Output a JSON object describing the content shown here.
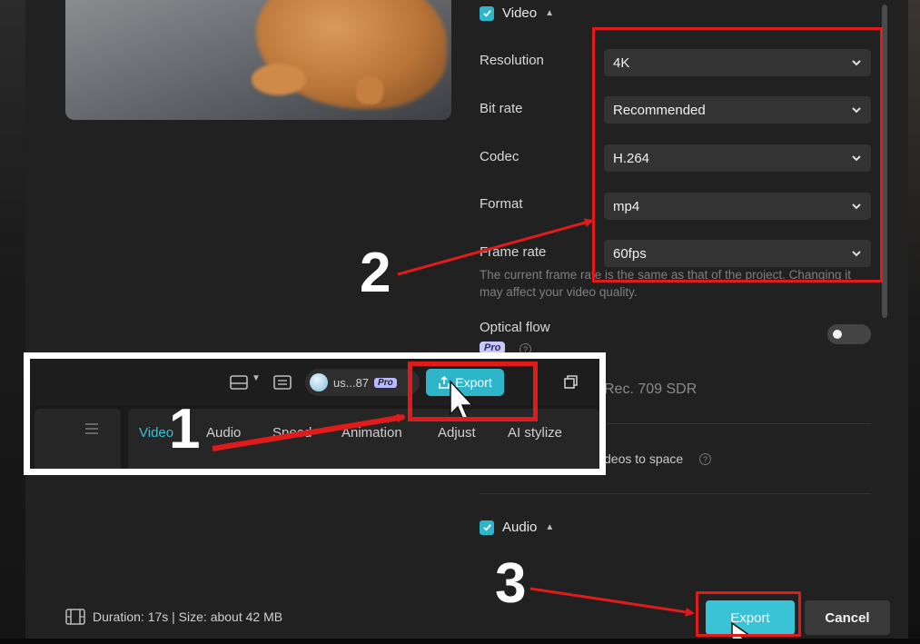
{
  "video_section": {
    "label": "Video",
    "checked": true
  },
  "settings": [
    {
      "label": "Resolution",
      "value": "4K"
    },
    {
      "label": "Bit rate",
      "value": "Recommended"
    },
    {
      "label": "Codec",
      "value": "H.264"
    },
    {
      "label": "Format",
      "value": "mp4"
    },
    {
      "label": "Frame rate",
      "value": "60fps"
    }
  ],
  "frame_rate_hint": "The current frame rate is the same as that of the project. Changing it may affect your video quality.",
  "optical_flow": {
    "label": "Optical flow",
    "badge": "Pro",
    "enabled": false
  },
  "color_space": "Rec. 709 SDR",
  "save_to_space": "deos to space",
  "audio_section": {
    "label": "Audio",
    "checked": true
  },
  "footer": {
    "info": "Duration: 17s | Size: about 42 MB"
  },
  "buttons": {
    "export": "Export",
    "cancel": "Cancel"
  },
  "annotations": {
    "step1": "1",
    "step2": "2",
    "step3": "3"
  },
  "inset": {
    "username": "us...87",
    "badge": "Pro",
    "export_label": "Export",
    "tabs": [
      "Video",
      "Audio",
      "Speed",
      "Animation",
      "Adjust",
      "AI stylize"
    ]
  },
  "colors": {
    "accent": "#39c2d5",
    "highlight": "#e01b1b",
    "dialog_bg": "#212121"
  }
}
